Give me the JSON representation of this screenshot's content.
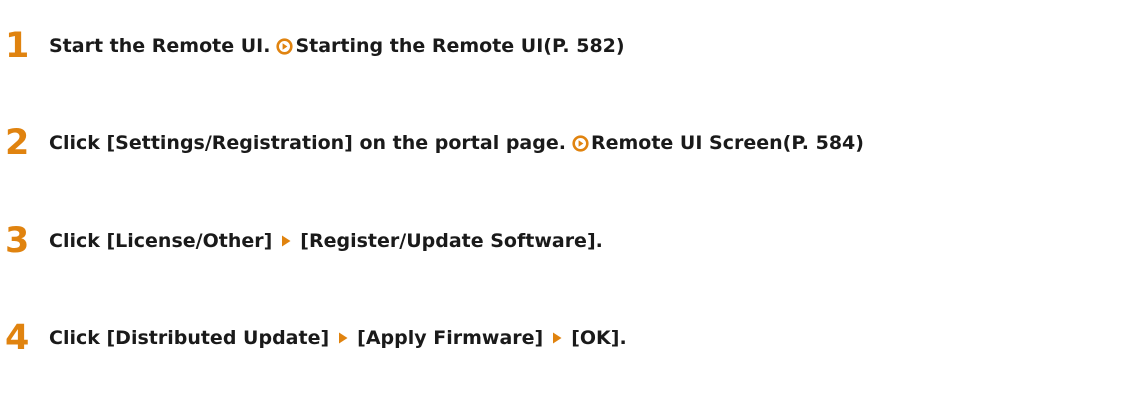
{
  "colors": {
    "step_number": "#e0830f",
    "link_icon": "#e0830f",
    "arrow_icon": "#e0830f",
    "text": "#1a1a1a"
  },
  "steps": [
    {
      "number": "1",
      "text": "Start the Remote UI.",
      "link": {
        "icon": "circle-arrow-icon",
        "label": "Starting the Remote UI(P. 582)"
      }
    },
    {
      "number": "2",
      "text": "Click [Settings/Registration] on the portal page.",
      "link": {
        "icon": "circle-arrow-icon",
        "label": "Remote UI Screen(P. 584)"
      }
    },
    {
      "number": "3",
      "parts": [
        "Click [License/Other]",
        "[Register/Update Software]."
      ],
      "separator_icon": "right-triangle-icon"
    },
    {
      "number": "4",
      "parts": [
        "Click [Distributed Update]",
        "[Apply Firmware]",
        "[OK]."
      ],
      "separator_icon": "right-triangle-icon"
    }
  ]
}
